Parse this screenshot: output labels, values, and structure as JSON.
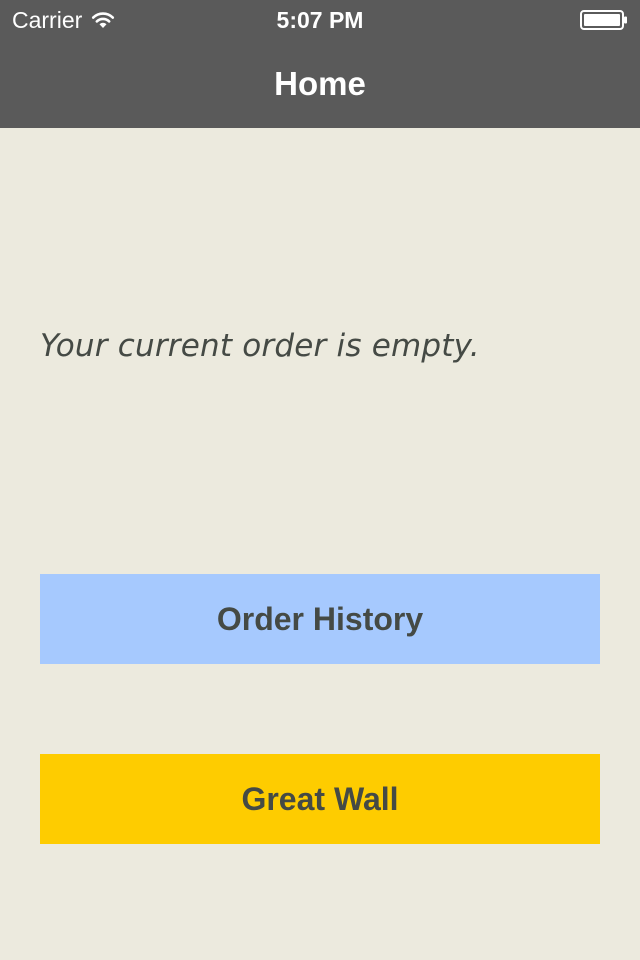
{
  "status_bar": {
    "carrier": "Carrier",
    "time": "5:07 PM",
    "wifi_icon": "wifi-icon",
    "battery_icon": "battery-icon"
  },
  "nav": {
    "title": "Home"
  },
  "main": {
    "empty_message": "Your current order is empty.",
    "order_history_label": "Order History",
    "great_wall_label": "Great Wall"
  },
  "colors": {
    "bar_background": "#5a5a5a",
    "page_background": "#eceade",
    "order_history_button": "#a6c9fe",
    "great_wall_button": "#fecc00",
    "text_dark": "#454a45"
  }
}
